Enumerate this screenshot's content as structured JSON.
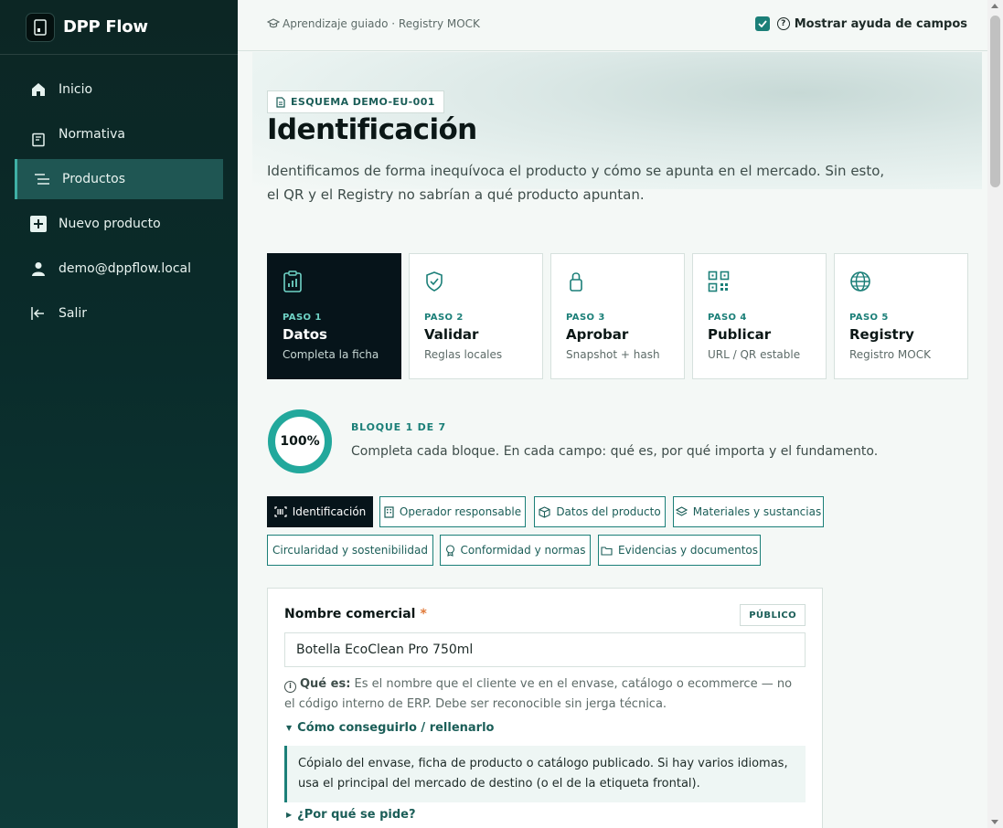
{
  "app": {
    "name": "DPP Flow"
  },
  "sidebar": {
    "items": [
      {
        "label": "Inicio",
        "icon": "home-icon"
      },
      {
        "label": "Normativa",
        "icon": "book-icon"
      },
      {
        "label": "Productos",
        "icon": "list-icon",
        "active": true
      },
      {
        "label": "Nuevo producto",
        "icon": "plus-square-icon"
      },
      {
        "label": "demo@dppflow.local",
        "icon": "user-icon"
      },
      {
        "label": "Salir",
        "icon": "logout-icon"
      }
    ]
  },
  "topbar": {
    "breadcrumb": "Aprendizaje guiado · Registry MOCK",
    "help_toggle_label": "Mostrar ayuda de campos",
    "help_toggle_checked": true
  },
  "hero": {
    "schema_badge": "ESQUEMA DEMO-EU-001",
    "title": "Identificación",
    "description": "Identificamos de forma inequívoca el producto y cómo se apunta en el mercado. Sin esto, el QR y el Registry no sabrían a qué producto apuntan."
  },
  "steps": [
    {
      "num": "PASO 1",
      "name": "Datos",
      "sub": "Completa la ficha",
      "icon": "clipboard-chart-icon",
      "active": true
    },
    {
      "num": "PASO 2",
      "name": "Validar",
      "sub": "Reglas locales",
      "icon": "shield-check-icon"
    },
    {
      "num": "PASO 3",
      "name": "Aprobar",
      "sub": "Snapshot + hash",
      "icon": "lock-icon"
    },
    {
      "num": "PASO 4",
      "name": "Publicar",
      "sub": "URL / QR estable",
      "icon": "qr-code-icon"
    },
    {
      "num": "PASO 5",
      "name": "Registry",
      "sub": "Registro MOCK",
      "icon": "globe-icon"
    }
  ],
  "progress": {
    "percent_label": "100%",
    "percent": 100,
    "block_label": "BLOQUE 1 DE 7",
    "block_desc": "Completa cada bloque. En cada campo: qué es, por qué importa y el fundamento."
  },
  "tabs": [
    {
      "label": "Identificación",
      "icon": "barcode-icon",
      "active": true
    },
    {
      "label": "Operador responsable",
      "icon": "building-icon"
    },
    {
      "label": "Datos del producto",
      "icon": "box-icon"
    },
    {
      "label": "Materiales y sustancias",
      "icon": "layers-icon"
    },
    {
      "label": "Circularidad y sostenibilidad",
      "icon": ""
    },
    {
      "label": "Conformidad y normas",
      "icon": "award-icon"
    },
    {
      "label": "Evidencias y documentos",
      "icon": "folder-icon"
    }
  ],
  "field": {
    "label": "Nombre comercial",
    "required_mark": "*",
    "visibility_badge": "PÚBLICO",
    "value": "Botella EcoClean Pro 750ml",
    "help_prefix": "Qué es:",
    "help_text": "Es el nombre que el cliente ve en el envase, catálogo o ecommerce — no el código interno de ERP. Debe ser reconocible sin jerga técnica.",
    "how_to_title": "Cómo conseguirlo / rellenarlo",
    "how_to_body": "Cópialo del envase, ficha de producto o catálogo publicado. Si hay varios idiomas, usa el principal del mercado de destino (o el de la etiqueta frontal).",
    "why_title": "¿Por qué se pide?"
  },
  "colors": {
    "accent": "#1b7f78",
    "dark": "#06141a",
    "sidebar": "#0c2624",
    "required": "#e07a3a"
  }
}
